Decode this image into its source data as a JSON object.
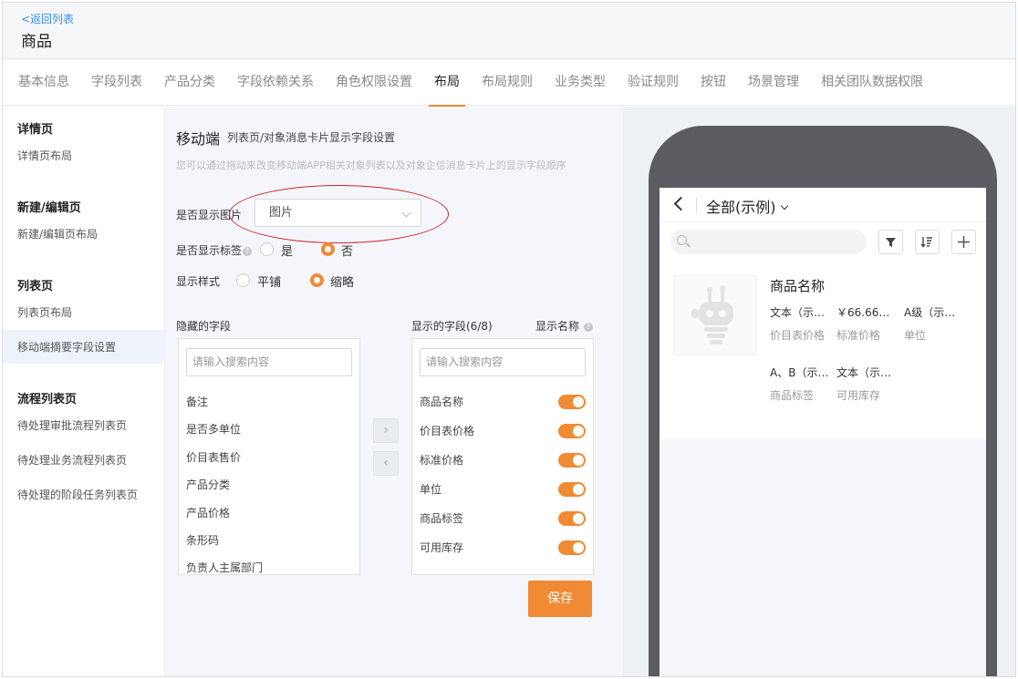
{
  "header": {
    "back_label": "<返回列表",
    "title": "商品"
  },
  "tabs": [
    {
      "label": "基本信息"
    },
    {
      "label": "字段列表"
    },
    {
      "label": "产品分类"
    },
    {
      "label": "字段依赖关系"
    },
    {
      "label": "角色权限设置"
    },
    {
      "label": "布局"
    },
    {
      "label": "布局规则"
    },
    {
      "label": "业务类型"
    },
    {
      "label": "验证规则"
    },
    {
      "label": "按钮"
    },
    {
      "label": "场景管理"
    },
    {
      "label": "相关团队数据权限"
    }
  ],
  "active_tab": "布局",
  "sidebar": {
    "groups": [
      {
        "title": "详情页",
        "items": [
          "详情页布局"
        ]
      },
      {
        "title": "新建/编辑页",
        "items": [
          "新建/编辑页布局"
        ]
      },
      {
        "title": "列表页",
        "items": [
          "列表页布局",
          "移动端摘要字段设置"
        ]
      },
      {
        "title": "流程列表页",
        "items": [
          "待处理审批流程列表页",
          "待处理业务流程列表页",
          "待处理的阶段任务列表页"
        ]
      }
    ],
    "selected": "移动端摘要字段设置"
  },
  "main": {
    "title": "移动端",
    "subtitle": "列表页/对象消息卡片显示字段设置",
    "description": "您可以通过拖动来改变移动端APP相关对象列表以及对象企信消息卡片上的显示字段顺序",
    "show_image_label": "是否显示图片",
    "show_image_value": "图片",
    "show_tag_label": "是否显示标签",
    "show_tag_options": [
      "是",
      "否"
    ],
    "show_tag_selected": "否",
    "style_label": "显示样式",
    "style_options": [
      "平铺",
      "缩略"
    ],
    "style_selected": "缩略",
    "hidden_fields_title": "隐藏的字段",
    "visible_fields_title": "显示的字段(6/8)",
    "show_name_label": "显示名称",
    "search_placeholder": "请输入搜索内容",
    "hidden_fields": [
      "备注",
      "是否多单位",
      "价目表售价",
      "产品分类",
      "产品价格",
      "条形码",
      "负责人主属部门"
    ],
    "visible_fields": [
      "商品名称",
      "价目表价格",
      "标准价格",
      "单位",
      "商品标签",
      "可用库存"
    ],
    "save_label": "保存"
  },
  "preview": {
    "title": "全部(示例)",
    "card_name": "商品名称",
    "rows": [
      [
        {
          "value": "文本（示…",
          "key": "价目表价格"
        },
        {
          "value": "￥66.66…",
          "key": "标准价格"
        },
        {
          "value": "A级（示…",
          "key": "单位"
        }
      ],
      [
        {
          "value": "A、B（示…",
          "key": "商品标签"
        },
        {
          "value": "文本（示…",
          "key": "可用库存"
        }
      ]
    ]
  }
}
